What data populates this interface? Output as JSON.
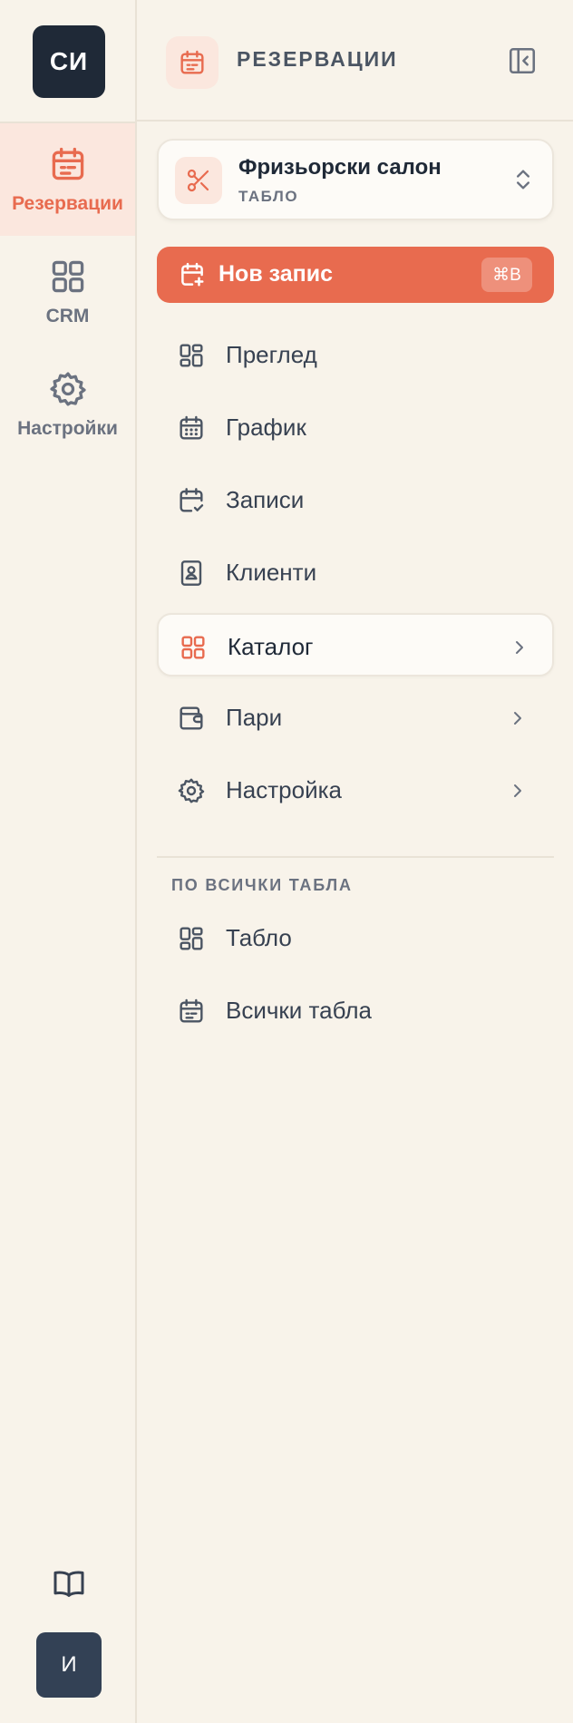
{
  "rail": {
    "logo_text": "СИ",
    "items": [
      {
        "label": "Резервации",
        "icon": "calendar-icon",
        "active": true
      },
      {
        "label": "CRM",
        "icon": "grid-icon",
        "active": false
      },
      {
        "label": "Настройки",
        "icon": "gear-icon",
        "active": false
      }
    ],
    "avatar_text": "И"
  },
  "header": {
    "title": "РЕЗЕРВАЦИИ"
  },
  "board": {
    "name": "Фризьорски салон",
    "subtitle": "ТАБЛО"
  },
  "new_button": {
    "label": "Нов запис",
    "shortcut": "⌘B"
  },
  "nav": [
    {
      "label": "Преглед",
      "icon": "dashboard-icon",
      "chevron": false,
      "highlight": false
    },
    {
      "label": "График",
      "icon": "calendar-grid-icon",
      "chevron": false,
      "highlight": false
    },
    {
      "label": "Записи",
      "icon": "calendar-check-icon",
      "chevron": false,
      "highlight": false
    },
    {
      "label": "Клиенти",
      "icon": "contact-book-icon",
      "chevron": false,
      "highlight": false
    },
    {
      "label": "Каталог",
      "icon": "grid-icon",
      "chevron": true,
      "highlight": true
    },
    {
      "label": "Пари",
      "icon": "wallet-icon",
      "chevron": true,
      "highlight": false
    },
    {
      "label": "Настройка",
      "icon": "gear-icon",
      "chevron": true,
      "highlight": false
    }
  ],
  "all_boards": {
    "section_label": "ПО ВСИЧКИ ТАБЛА",
    "items": [
      {
        "label": "Табло",
        "icon": "dashboard-icon"
      },
      {
        "label": "Всички табла",
        "icon": "calendar-list-icon"
      }
    ]
  },
  "colors": {
    "accent": "#e86b4f",
    "background": "#f8f3ea",
    "active_tint": "#fbe7de",
    "logo_bg": "#1f2937"
  }
}
